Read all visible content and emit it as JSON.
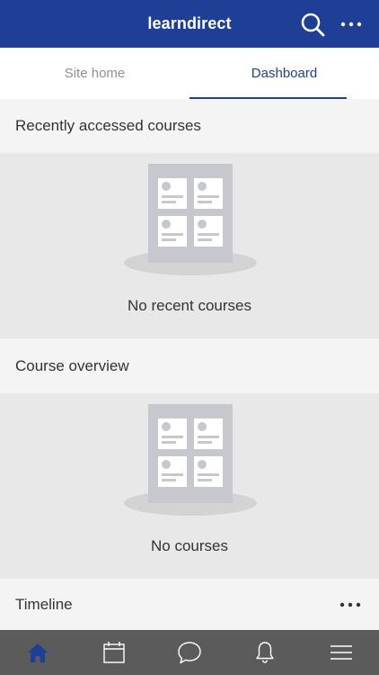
{
  "header": {
    "title": "learndirect",
    "icons": [
      "search-icon",
      "more-icon"
    ],
    "brand_color": "#1f3e96"
  },
  "tabs": [
    {
      "label": "Site home",
      "active": false
    },
    {
      "label": "Dashboard",
      "active": true
    }
  ],
  "blocks": {
    "recent": {
      "title": "Recently accessed courses",
      "empty_text": "No recent courses",
      "icon": "courses-illustration"
    },
    "overview": {
      "title": "Course overview",
      "empty_text": "No courses",
      "icon": "courses-illustration"
    },
    "timeline": {
      "title": "Timeline",
      "icon": "more-icon"
    }
  },
  "bottom_nav": {
    "items": [
      "home-icon",
      "calendar-icon",
      "messages-icon",
      "notifications-icon",
      "menu-icon"
    ],
    "active": "home-icon"
  }
}
